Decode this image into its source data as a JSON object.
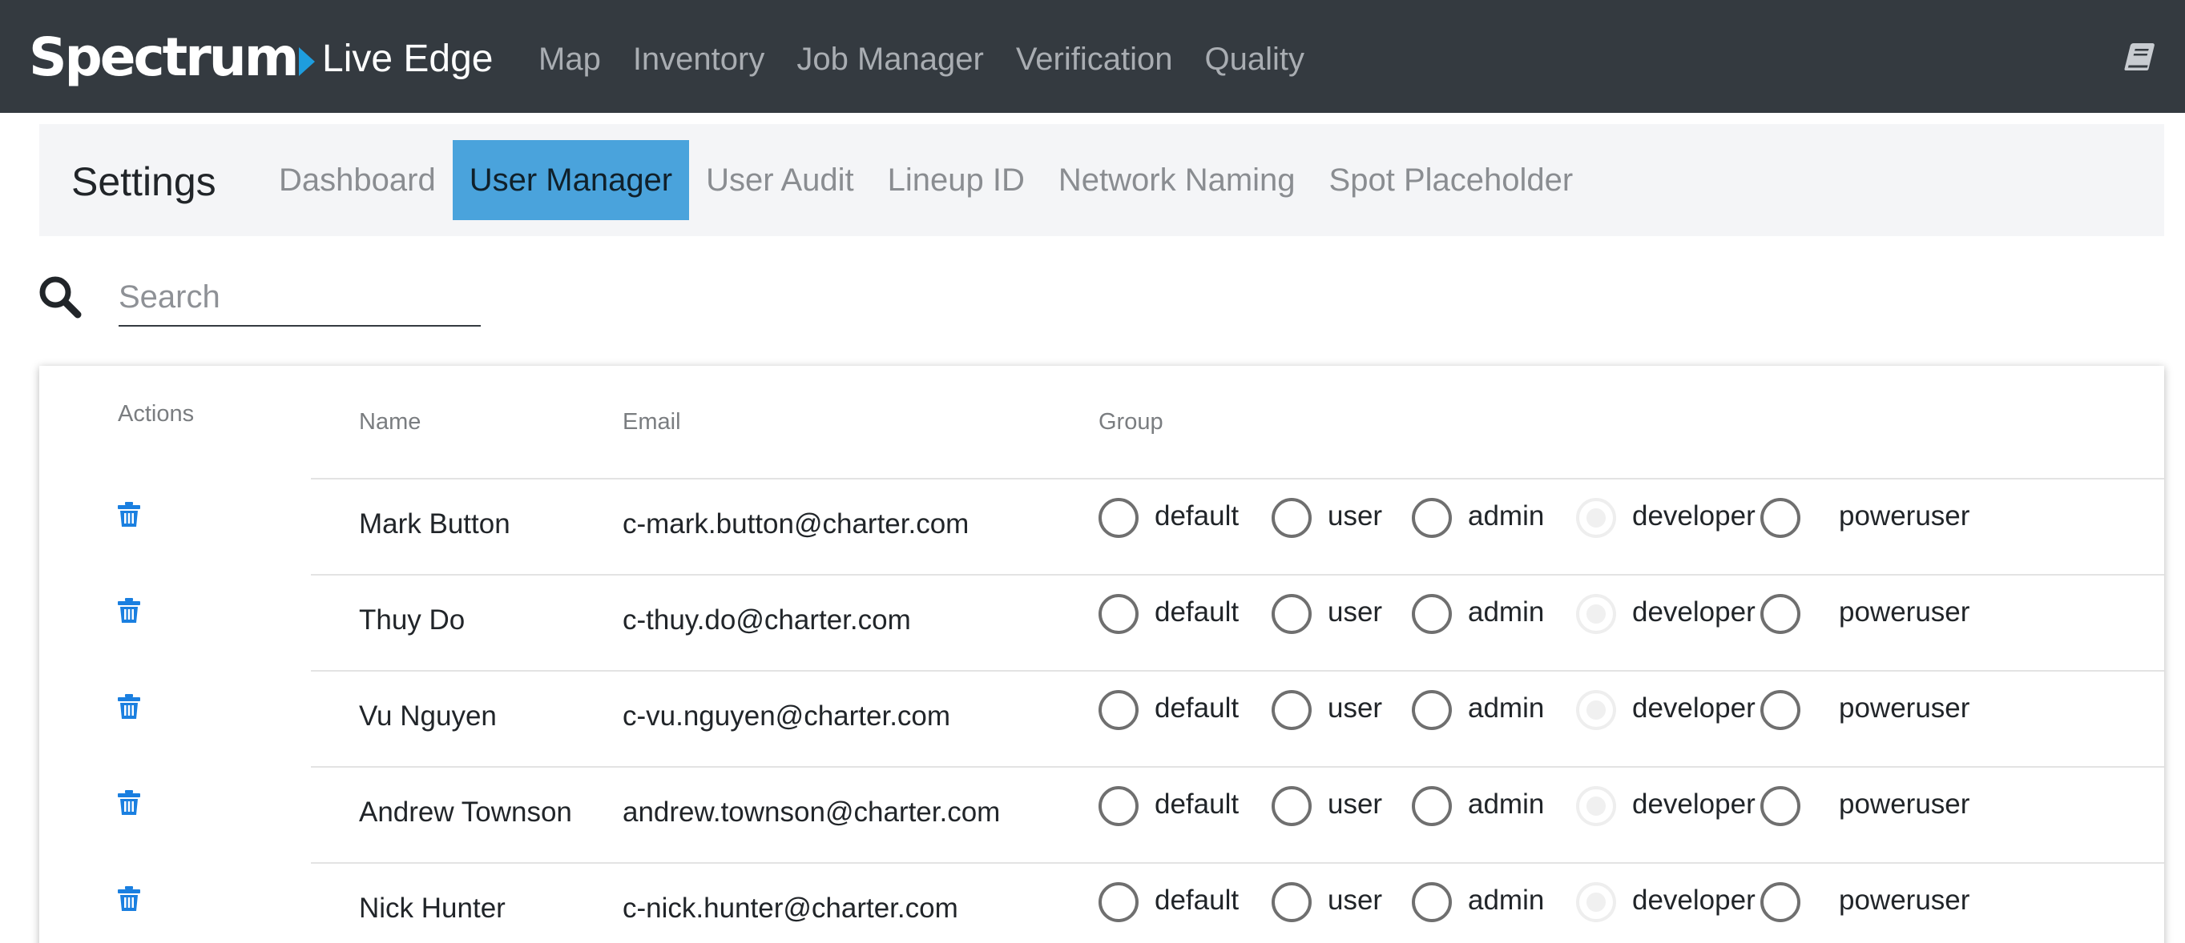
{
  "brand": {
    "logo_text": "Spectrum",
    "app_title": "Live Edge"
  },
  "topnav": {
    "items": [
      "Map",
      "Inventory",
      "Job Manager",
      "Verification",
      "Quality"
    ]
  },
  "settings": {
    "title": "Settings",
    "tabs": [
      "Dashboard",
      "User Manager",
      "User Audit",
      "Lineup ID",
      "Network Naming",
      "Spot Placeholder"
    ],
    "active_tab": "User Manager"
  },
  "search": {
    "placeholder": "Search",
    "value": ""
  },
  "table": {
    "headers": {
      "actions": "Actions",
      "name": "Name",
      "email": "Email",
      "group": "Group"
    },
    "group_options": [
      "default",
      "user",
      "admin",
      "developer",
      "poweruser"
    ],
    "rows": [
      {
        "name": "Mark Button",
        "email": "c-mark.button@charter.com",
        "disabled_option": "developer"
      },
      {
        "name": "Thuy Do",
        "email": "c-thuy.do@charter.com",
        "disabled_option": "developer"
      },
      {
        "name": "Vu Nguyen",
        "email": "c-vu.nguyen@charter.com",
        "disabled_option": "developer"
      },
      {
        "name": "Andrew Townson",
        "email": "andrew.townson@charter.com",
        "disabled_option": "developer"
      },
      {
        "name": "Nick Hunter",
        "email": "c-nick.hunter@charter.com",
        "disabled_option": "developer"
      }
    ]
  },
  "colors": {
    "nav_bg": "#343a40",
    "active_tab": "#4aa3dc",
    "trash_icon": "#1a7fe0",
    "logo_arrow": "#1e9dde"
  }
}
